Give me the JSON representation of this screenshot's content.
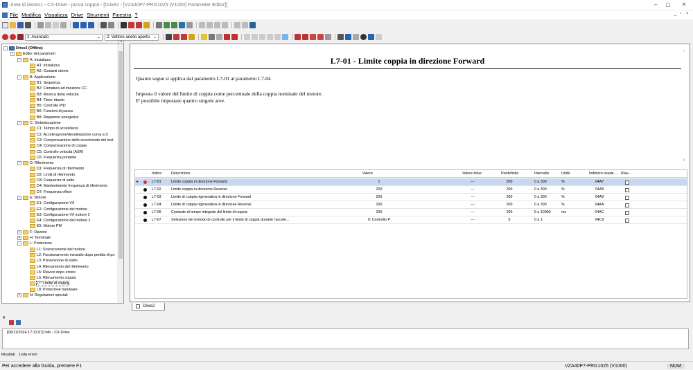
{
  "window": {
    "title": "Area di lavoro1 - CX-Drive - prova coppia - [Drive2 - [VZA40P7-PRG1025 (V1000) Parameter Editor]]"
  },
  "menu": [
    "File",
    "Modifica",
    "Visualizza",
    "Drive",
    "Strumenti",
    "Finestra",
    "?"
  ],
  "toolbar": {
    "mode_combo": "2: Avanzato",
    "view_combo": "2: Vettore anello aperto"
  },
  "tree": [
    {
      "label": "Drive2 (Offline)",
      "level": 0,
      "bold": true,
      "exp": "-"
    },
    {
      "label": "Editor dei parametri",
      "level": 1,
      "exp": "-"
    },
    {
      "label": "A: Inizializza",
      "level": 2,
      "exp": "-"
    },
    {
      "label": "A1: Inizializza",
      "level": 3
    },
    {
      "label": "A2: Costanti utente",
      "level": 3
    },
    {
      "label": "B: Applicazione",
      "level": 2,
      "exp": "-"
    },
    {
      "label": "B1: Sequenza",
      "level": 3
    },
    {
      "label": "B2: Frenatura ad iniezione CC",
      "level": 3
    },
    {
      "label": "B3: Ricerca della velocità",
      "level": 3
    },
    {
      "label": "B4: Timer ritardo",
      "level": 3
    },
    {
      "label": "B5: Controllo PID",
      "level": 3
    },
    {
      "label": "B6: Funzioni di pausa",
      "level": 3
    },
    {
      "label": "B8: Risparmio energetico",
      "level": 3
    },
    {
      "label": "C: Sintonizzazione",
      "level": 2,
      "exp": "-"
    },
    {
      "label": "C1: Tempo di accel/decel",
      "level": 3
    },
    {
      "label": "C2: Accelerazione/decelerazione curva a S",
      "level": 3
    },
    {
      "label": "C3: Compensazione dello scorrimento del mot",
      "level": 3
    },
    {
      "label": "C4: Compensazione di coppia",
      "level": 3
    },
    {
      "label": "C5: Controllo velocità (ASR)",
      "level": 3
    },
    {
      "label": "C6: Frequenza portante",
      "level": 3
    },
    {
      "label": "D: Riferimento",
      "level": 2,
      "exp": "-"
    },
    {
      "label": "D1: Frequenza di riferimento",
      "level": 3
    },
    {
      "label": "D2: Limiti di riferimento",
      "level": 3
    },
    {
      "label": "D3: Frequenze di salto",
      "level": 3
    },
    {
      "label": "D4: Mantenimento frequenza di riferimento",
      "level": 3
    },
    {
      "label": "D7: Frequenza offset",
      "level": 3
    },
    {
      "label": "E: Motore",
      "level": 2,
      "exp": "-"
    },
    {
      "label": "E1: Configurazione V/f",
      "level": 3
    },
    {
      "label": "E2: Configurazione del motore",
      "level": 3
    },
    {
      "label": "E3: Configurazione V/f motore 2",
      "level": 3
    },
    {
      "label": "E4: Configurazione del motore 2",
      "level": 3
    },
    {
      "label": "E5: Motore PM",
      "level": 3
    },
    {
      "label": "F: Opzioni",
      "level": 2,
      "exp": "+"
    },
    {
      "label": "H: Terminale",
      "level": 2,
      "exp": "+"
    },
    {
      "label": "L: Protezione",
      "level": 2,
      "exp": "-"
    },
    {
      "label": "L1: Sovracorrente del motore",
      "level": 3
    },
    {
      "label": "L2: Funzionamento inerziale dopo perdita di po",
      "level": 3
    },
    {
      "label": "L3: Prevenzione di stallo",
      "level": 3
    },
    {
      "label": "L4: Rilevamento del riferimento",
      "level": 3
    },
    {
      "label": "L5: Riavvio dopo errore",
      "level": 3
    },
    {
      "label": "L6: Rilevamento coppia",
      "level": 3
    },
    {
      "label": "L7: Limite di coppia",
      "level": 3,
      "sel": true
    },
    {
      "label": "L8: Protezione hardware",
      "level": 3
    },
    {
      "label": "N: Regolazioni speciali",
      "level": 2,
      "exp": "+"
    }
  ],
  "doc": {
    "title": "L7-01 - Limite coppia in direzione Forward",
    "p1": "Quanto segue si applica dal parametro L7-01 al parametro L7-04",
    "p2": "Imposta il valore del limite di coppia come percentuale della coppia nominale del motore.",
    "p3": "E' possibile impostare quattro singole aree."
  },
  "grid": {
    "headers": {
      "dots": "...",
      "index": "Indice",
      "desc": "Descrizione",
      "value": "Valore",
      "drive": "Valore drive",
      "def": "Predefinito",
      "range": "Intervallo",
      "unit": "Unità",
      "addr": "Indirizzo esade...",
      "riav": "Riav..."
    },
    "rows": [
      {
        "index": "L7-01",
        "desc": "Limite coppia in direzione Forward",
        "value": "1",
        "drive": "---",
        "def": "200",
        "range": "0 a 300",
        "unit": "%",
        "addr": "04A7",
        "dot": "#d23030",
        "sel": true
      },
      {
        "index": "L7-02",
        "desc": "Limite coppia in direzione Reverse",
        "value": "200",
        "drive": "---",
        "def": "200",
        "range": "0 a 300",
        "unit": "%",
        "addr": "04A8",
        "dot": "#111"
      },
      {
        "index": "L7-03",
        "desc": "Limite di coppia rigenerativa in direzione Forward",
        "value": "200",
        "drive": "---",
        "def": "200",
        "range": "0 a 300",
        "unit": "%",
        "addr": "04A9",
        "dot": "#111"
      },
      {
        "index": "L7-04",
        "desc": "Limite di coppia rigenerativa in direzione Reverse",
        "value": "200",
        "drive": "---",
        "def": "200",
        "range": "0 a 300",
        "unit": "%",
        "addr": "04AA",
        "dot": "#111"
      },
      {
        "index": "L7-06",
        "desc": "Costante di tempo integrale del limite di coppia",
        "value": "200",
        "drive": "---",
        "def": "200",
        "range": "5 a 10000",
        "unit": "ms",
        "addr": "04AC",
        "dot": "#111"
      },
      {
        "index": "L7-07",
        "desc": "Selezione del metodo di controllo per il limite di coppia durante l'accele...",
        "value": "0: Controllo P",
        "drive": "---",
        "def": "0",
        "range": "0 a 1",
        "unit": "",
        "addr": "04C9",
        "dot": "#111"
      }
    ]
  },
  "tab": "Drive2",
  "log": {
    "line": "[06/11/2024 17:11:07] Info  - CX-Drive"
  },
  "bottom_tabs": [
    "Risultati",
    "Lista errori"
  ],
  "status": {
    "help": "Per accedere alla Guida, premere F1",
    "device": "VZA40P7-PRG1025 (V1000)",
    "num": "NUM"
  }
}
